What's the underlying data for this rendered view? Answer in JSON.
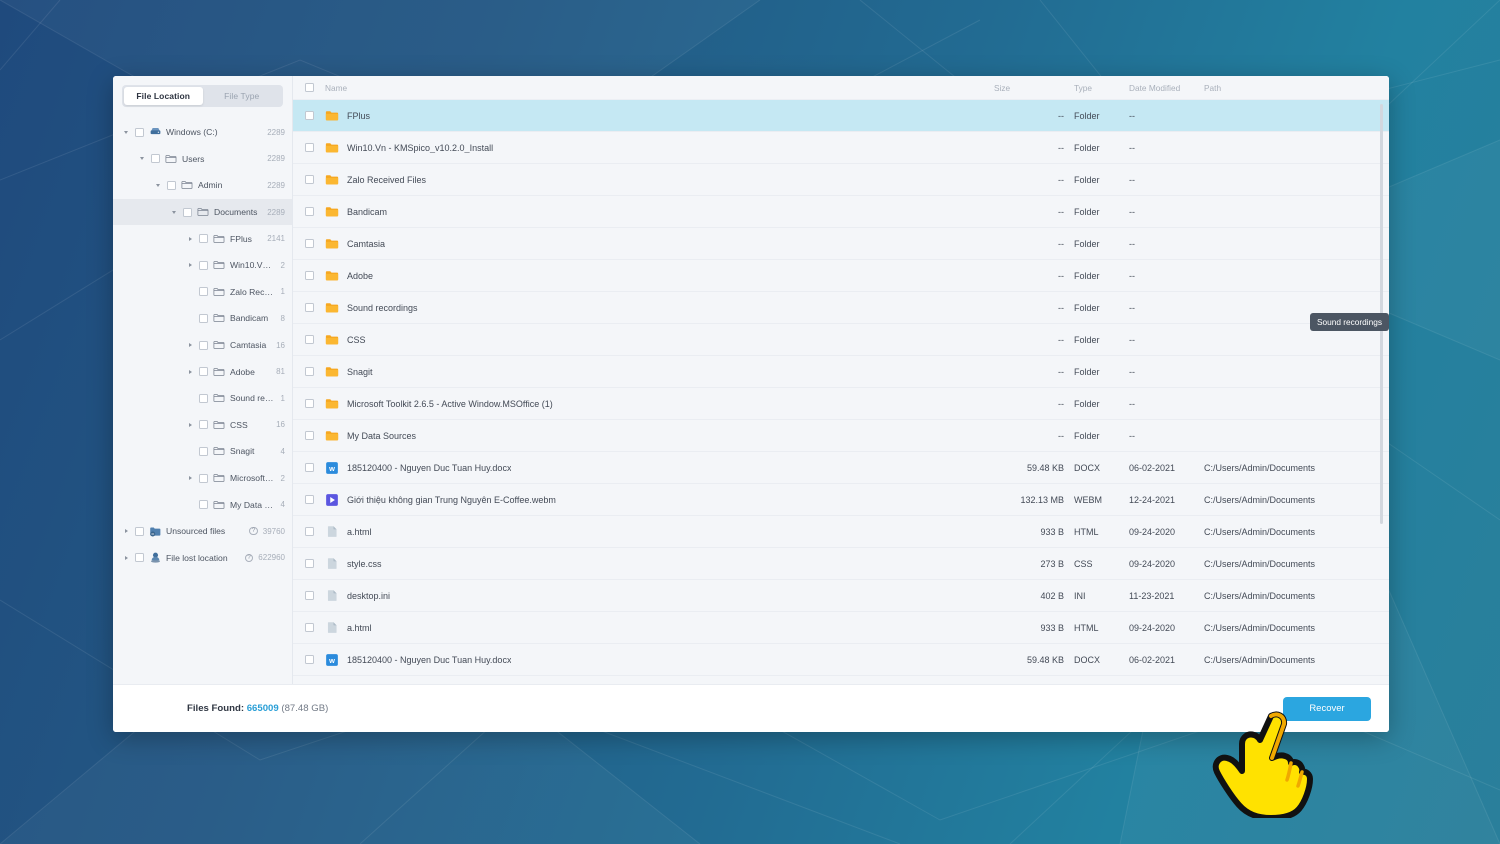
{
  "sidebar": {
    "tabs": [
      {
        "label": "File Location",
        "active": true
      },
      {
        "label": "File Type",
        "active": false
      }
    ],
    "tree": [
      {
        "label": "Windows (C:)",
        "count": "2289",
        "depth": 0,
        "caret": "open",
        "icon": "drive-icon",
        "selected": false,
        "help": false
      },
      {
        "label": "Users",
        "count": "2289",
        "depth": 1,
        "caret": "open",
        "icon": "folder-icon",
        "selected": false,
        "help": false
      },
      {
        "label": "Admin",
        "count": "2289",
        "depth": 2,
        "caret": "open",
        "icon": "folder-icon",
        "selected": false,
        "help": false
      },
      {
        "label": "Documents",
        "count": "2289",
        "depth": 3,
        "caret": "open",
        "icon": "folder-icon",
        "selected": true,
        "help": false
      },
      {
        "label": "FPlus",
        "count": "2141",
        "depth": 4,
        "caret": "closed",
        "icon": "folder-icon",
        "selected": false,
        "help": false
      },
      {
        "label": "Win10.Vn - KMS...",
        "count": "2",
        "depth": 4,
        "caret": "closed",
        "icon": "folder-icon",
        "selected": false,
        "help": false
      },
      {
        "label": "Zalo Received Fil...",
        "count": "1",
        "depth": 4,
        "caret": "none",
        "icon": "folder-icon",
        "selected": false,
        "help": false
      },
      {
        "label": "Bandicam",
        "count": "8",
        "depth": 4,
        "caret": "none",
        "icon": "folder-icon",
        "selected": false,
        "help": false
      },
      {
        "label": "Camtasia",
        "count": "16",
        "depth": 4,
        "caret": "closed",
        "icon": "folder-icon",
        "selected": false,
        "help": false
      },
      {
        "label": "Adobe",
        "count": "81",
        "depth": 4,
        "caret": "closed",
        "icon": "folder-icon",
        "selected": false,
        "help": false
      },
      {
        "label": "Sound recordings",
        "count": "1",
        "depth": 4,
        "caret": "none",
        "icon": "folder-icon",
        "selected": false,
        "help": false
      },
      {
        "label": "CSS",
        "count": "16",
        "depth": 4,
        "caret": "closed",
        "icon": "folder-icon",
        "selected": false,
        "help": false
      },
      {
        "label": "Snagit",
        "count": "4",
        "depth": 4,
        "caret": "none",
        "icon": "folder-icon",
        "selected": false,
        "help": false
      },
      {
        "label": "Microsoft Toolki...",
        "count": "2",
        "depth": 4,
        "caret": "closed",
        "icon": "folder-icon",
        "selected": false,
        "help": false
      },
      {
        "label": "My Data Sources",
        "count": "4",
        "depth": 4,
        "caret": "none",
        "icon": "folder-icon",
        "selected": false,
        "help": false
      },
      {
        "label": "Unsourced files",
        "count": "39760",
        "depth": 0,
        "caret": "closed",
        "icon": "unsourced-icon",
        "selected": false,
        "help": true
      },
      {
        "label": "File lost location",
        "count": "622960",
        "depth": 0,
        "caret": "closed",
        "icon": "lost-location-icon",
        "selected": false,
        "help": true
      }
    ]
  },
  "list": {
    "columns": {
      "name": "Name",
      "size": "Size",
      "type": "Type",
      "date": "Date Modified",
      "path": "Path"
    },
    "rows": [
      {
        "name": "FPlus",
        "size": "--",
        "type": "Folder",
        "date": "--",
        "path": "",
        "icon": "folder-icon",
        "selected": true
      },
      {
        "name": "Win10.Vn - KMSpico_v10.2.0_Install",
        "size": "--",
        "type": "Folder",
        "date": "--",
        "path": "",
        "icon": "folder-icon",
        "selected": false
      },
      {
        "name": "Zalo Received Files",
        "size": "--",
        "type": "Folder",
        "date": "--",
        "path": "",
        "icon": "folder-icon",
        "selected": false
      },
      {
        "name": "Bandicam",
        "size": "--",
        "type": "Folder",
        "date": "--",
        "path": "",
        "icon": "folder-icon",
        "selected": false
      },
      {
        "name": "Camtasia",
        "size": "--",
        "type": "Folder",
        "date": "--",
        "path": "",
        "icon": "folder-icon",
        "selected": false
      },
      {
        "name": "Adobe",
        "size": "--",
        "type": "Folder",
        "date": "--",
        "path": "",
        "icon": "folder-icon",
        "selected": false
      },
      {
        "name": "Sound recordings",
        "size": "--",
        "type": "Folder",
        "date": "--",
        "path": "",
        "icon": "folder-icon",
        "selected": false
      },
      {
        "name": "CSS",
        "size": "--",
        "type": "Folder",
        "date": "--",
        "path": "",
        "icon": "folder-icon",
        "selected": false
      },
      {
        "name": "Snagit",
        "size": "--",
        "type": "Folder",
        "date": "--",
        "path": "",
        "icon": "folder-icon",
        "selected": false
      },
      {
        "name": "Microsoft Toolkit 2.6.5 - Active Window.MSOffice (1)",
        "size": "--",
        "type": "Folder",
        "date": "--",
        "path": "",
        "icon": "folder-icon",
        "selected": false
      },
      {
        "name": "My Data Sources",
        "size": "--",
        "type": "Folder",
        "date": "--",
        "path": "",
        "icon": "folder-icon",
        "selected": false
      },
      {
        "name": "185120400 - Nguyen Duc Tuan Huy.docx",
        "size": "59.48 KB",
        "type": "DOCX",
        "date": "06-02-2021",
        "path": "C:/Users/Admin/Documents",
        "icon": "word-icon",
        "selected": false
      },
      {
        "name": "Giới thiệu không gian Trung Nguyên E-Coffee.webm",
        "size": "132.13 MB",
        "type": "WEBM",
        "date": "12-24-2021",
        "path": "C:/Users/Admin/Documents",
        "icon": "video-icon",
        "selected": false
      },
      {
        "name": "a.html",
        "size": "933 B",
        "type": "HTML",
        "date": "09-24-2020",
        "path": "C:/Users/Admin/Documents",
        "icon": "file-icon",
        "selected": false
      },
      {
        "name": "style.css",
        "size": "273 B",
        "type": "CSS",
        "date": "09-24-2020",
        "path": "C:/Users/Admin/Documents",
        "icon": "file-icon",
        "selected": false
      },
      {
        "name": "desktop.ini",
        "size": "402 B",
        "type": "INI",
        "date": "11-23-2021",
        "path": "C:/Users/Admin/Documents",
        "icon": "file-icon",
        "selected": false
      },
      {
        "name": "a.html",
        "size": "933 B",
        "type": "HTML",
        "date": "09-24-2020",
        "path": "C:/Users/Admin/Documents",
        "icon": "file-icon",
        "selected": false
      },
      {
        "name": "185120400 - Nguyen Duc Tuan Huy.docx",
        "size": "59.48 KB",
        "type": "DOCX",
        "date": "06-02-2021",
        "path": "C:/Users/Admin/Documents",
        "icon": "word-icon",
        "selected": false
      }
    ]
  },
  "tooltip": {
    "text": "Sound recordings"
  },
  "footer": {
    "files_found_label": "Files Found:",
    "files_found_count": "665009",
    "files_found_size": "(87.48 GB)",
    "recover_label": "Recover"
  },
  "colors": {
    "accent": "#2ba6e0",
    "selection": "#c5e8f3",
    "folder": "#f6a721",
    "success": "#21c9c0",
    "cursor": "#ffe200"
  }
}
